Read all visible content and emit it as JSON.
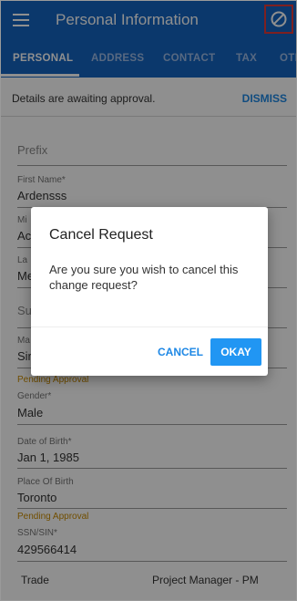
{
  "header": {
    "title": "Personal Information",
    "menu_icon": "hamburger-menu-icon",
    "action_icon": "cancel-request-icon"
  },
  "tabs": [
    {
      "label": "PERSONAL",
      "active": true
    },
    {
      "label": "ADDRESS"
    },
    {
      "label": "CONTACT"
    },
    {
      "label": "TAX"
    },
    {
      "label": "OTH"
    }
  ],
  "banner": {
    "text": "Details are awaiting approval.",
    "dismiss": "DISMISS"
  },
  "form": {
    "prefix_placeholder": "Prefix",
    "first_name_label": "First Name*",
    "first_name_value": "Ardensss",
    "middle_label": "Mi",
    "middle_value": "Ac",
    "last_label": "La",
    "last_value": "Me",
    "suffix_label": "Su",
    "marital_label": "Ma",
    "marital_value": "Sir",
    "pending_1": "Pending Approval",
    "gender_label": "Gender*",
    "gender_value": "Male",
    "dob_label": "Date of Birth*",
    "dob_value": "Jan 1, 1985",
    "pob_label": "Place Of Birth",
    "pob_value": "Toronto",
    "pending_2": "Pending Approval",
    "ssn_label": "SSN/SIN*",
    "ssn_value": "429566414",
    "trade_label": "Trade",
    "trade_value": "Project Manager - PM"
  },
  "dialog": {
    "title": "Cancel Request",
    "body": "Are you sure you wish to cancel this change request?",
    "cancel": "CANCEL",
    "okay": "OKAY"
  },
  "colors": {
    "primary": "#1565c0",
    "accent": "#2196f3",
    "pending": "#c98b00",
    "highlight": "#e03a3a"
  }
}
